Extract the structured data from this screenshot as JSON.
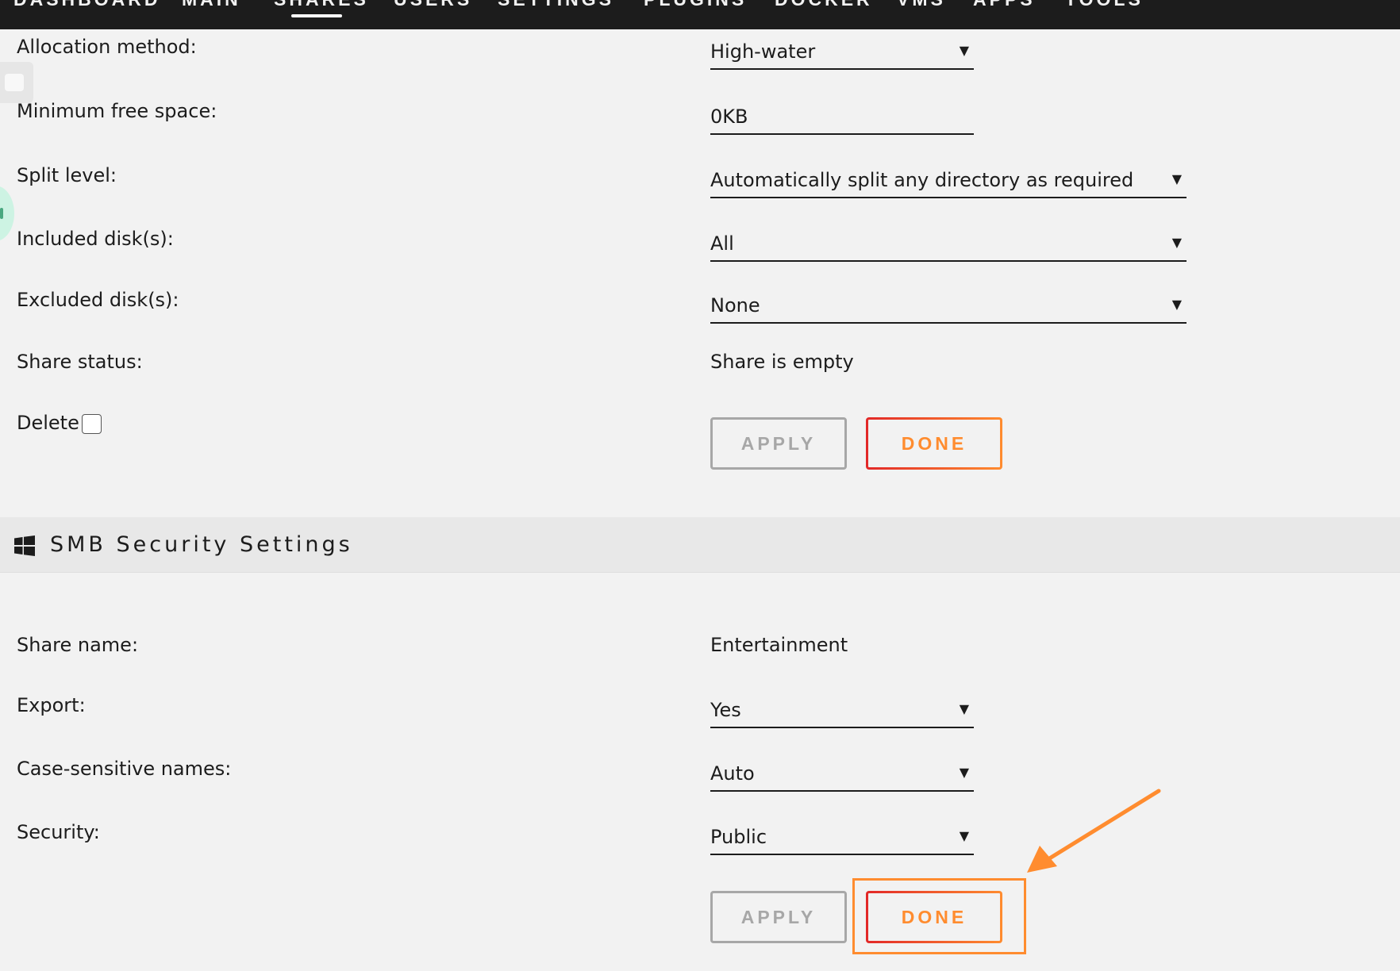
{
  "nav": {
    "items": [
      "DASHBOARD",
      "MAIN",
      "SHARES",
      "USERS",
      "SETTINGS",
      "PLUGINS",
      "DOCKER",
      "VMS",
      "APPS",
      "TOOLS"
    ],
    "active": "SHARES"
  },
  "share_settings": {
    "allocation_method": {
      "label": "Allocation method:",
      "value": "High-water"
    },
    "minimum_free_space": {
      "label": "Minimum free space:",
      "value": "0KB"
    },
    "split_level": {
      "label": "Split level:",
      "value": "Automatically split any directory as required"
    },
    "included_disks": {
      "label": "Included disk(s):",
      "value": "All"
    },
    "excluded_disks": {
      "label": "Excluded disk(s):",
      "value": "None"
    },
    "share_status": {
      "label": "Share status:",
      "value": "Share is empty"
    },
    "delete": {
      "label": "Delete",
      "checked": false
    },
    "apply_label": "APPLY",
    "done_label": "DONE"
  },
  "smb_section": {
    "title": "SMB Security Settings",
    "icon": "windows-icon",
    "share_name": {
      "label": "Share name:",
      "value": "Entertainment"
    },
    "export": {
      "label": "Export:",
      "value": "Yes"
    },
    "case_sensitive": {
      "label": "Case-sensitive names:",
      "value": "Auto"
    },
    "security": {
      "label": "Security:",
      "value": "Public"
    },
    "apply_label": "APPLY",
    "done_label": "DONE"
  },
  "icons": {
    "dropdown": "caret-down-icon",
    "annotation": "arrow-icon"
  },
  "colors": {
    "nav_bg": "#1c1c1c",
    "page_bg": "#f2f2f2",
    "section_bg": "#e8e8e8",
    "accent_orange": "#ff8c2f",
    "accent_red": "#e22828",
    "disabled_gray": "#a7a7a7"
  }
}
